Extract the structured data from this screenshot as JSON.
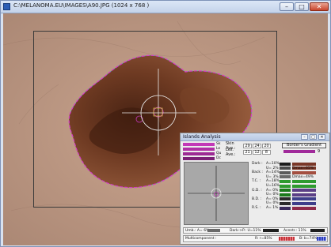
{
  "window": {
    "title": "C:\\MELANOMA.EU\\IMAGES\\A90.JPG (1024 x 768 )",
    "min": "–",
    "max": "□",
    "close": "✕"
  },
  "panel": {
    "title": "Islands Analysis",
    "swatch_labels": [
      "Sk",
      "Le",
      "Qu",
      "Dc"
    ],
    "skin_label": "Skin Ave.:",
    "skin_values": [
      "29",
      "24",
      "20"
    ],
    "lesion_label": "Les. Ave.:",
    "lesion_values": [
      "21",
      "12",
      "8"
    ],
    "border_label": "Border's Gradient",
    "border_value": "9",
    "rows": [
      {
        "name": "Dark :",
        "value": "A=10%",
        "c1": "#1b1b1b",
        "c2": "#7a3727",
        "extra": ""
      },
      {
        "name": "",
        "value": "U= 2%",
        "c1": "#4a4a4a",
        "c2": "#7a3727",
        "extra": "Dmax=65%"
      },
      {
        "name": "Back :",
        "value": "A=14%",
        "c1": "#5b5b5b",
        "c2": "#a44f40",
        "extra": ""
      },
      {
        "name": "",
        "value": "U= 3%",
        "c1": "#6a6a6a",
        "c2": "",
        "extra": "Dmax=49%"
      },
      {
        "name": "T.C. :",
        "value": "A=18%",
        "c1": "#2e9a2e",
        "c2": "#2e9a2e",
        "extra": ""
      },
      {
        "name": "",
        "value": "U=16%",
        "c1": "#2e9a2e",
        "c2": "#2e9a2e",
        "extra": ""
      },
      {
        "name": "G.D. :",
        "value": "A= 0%",
        "c1": "#1b7a1b",
        "c2": "#5b3f86",
        "extra": ""
      },
      {
        "name": "",
        "value": "U= 0%",
        "c1": "#1b7a1b",
        "c2": "#5b3f86",
        "extra": ""
      },
      {
        "name": "B.D. :",
        "value": "A= 0%",
        "c1": "#2a2a2a",
        "c2": "#3e3e8a",
        "extra": ""
      },
      {
        "name": "",
        "value": "U= 0%",
        "c1": "#2a2a2a",
        "c2": "#3e3e8a",
        "extra": ""
      },
      {
        "name": "R.S. :",
        "value": "A= 1%",
        "c1": "#3a2a5a",
        "c2": "#8e2a4a",
        "extra": ""
      }
    ],
    "umb": "Umb.: A= 6%",
    "dark_p": "Dark->P.: U=11%",
    "acentr": "Acentr.: 11%",
    "multicomponent": "Multicomponent :",
    "r_label": "R: r=85%",
    "b_label": "B: b=74%"
  }
}
